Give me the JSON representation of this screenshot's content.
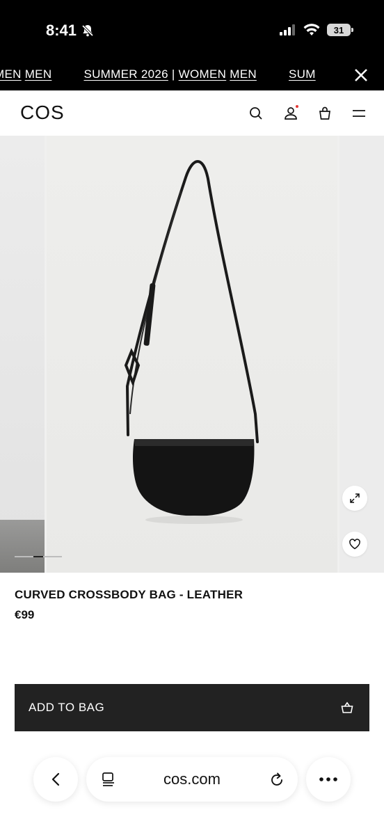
{
  "status_bar": {
    "time": "8:41",
    "battery": "31"
  },
  "ticker": {
    "items": [
      "MEN",
      "MEN",
      "SUMMER 2026",
      "|",
      "WOMEN",
      "MEN",
      "SUM"
    ]
  },
  "header": {
    "logo": "COS"
  },
  "product": {
    "name": "CURVED CROSSBODY BAG - LEATHER",
    "price": "€99",
    "gallery_index": 2,
    "gallery_count": 5
  },
  "actions": {
    "add_to_bag": "ADD TO BAG"
  },
  "browser": {
    "url": "cos.com"
  }
}
